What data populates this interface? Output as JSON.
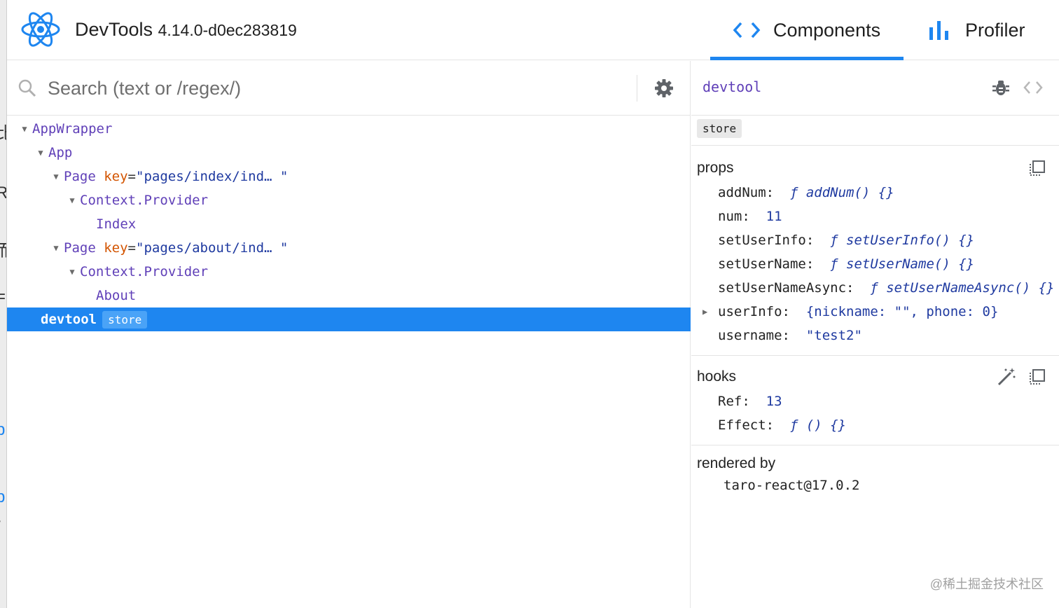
{
  "app": {
    "title": "DevTools",
    "version": "4.14.0-d0ec283819",
    "tabs": [
      {
        "label": "Components",
        "active": true
      },
      {
        "label": "Profiler",
        "active": false
      }
    ]
  },
  "search": {
    "placeholder": "Search (text or /regex/)",
    "value": ""
  },
  "tree": [
    {
      "name": "AppWrapper",
      "depth": 0,
      "expanded": true
    },
    {
      "name": "App",
      "depth": 1,
      "expanded": true
    },
    {
      "name": "Page",
      "key_label": "key",
      "key_value": "\"pages/index/ind… \"",
      "depth": 2,
      "expanded": true
    },
    {
      "name": "Context.Provider",
      "depth": 3,
      "expanded": true
    },
    {
      "name": "Index",
      "depth": 4
    },
    {
      "name": "Page",
      "key_label": "key",
      "key_value": "\"pages/about/ind… \"",
      "depth": 2,
      "expanded": true
    },
    {
      "name": "Context.Provider",
      "depth": 3,
      "expanded": true
    },
    {
      "name": "About",
      "depth": 4
    },
    {
      "name": "devtool",
      "badge": "store",
      "depth": 1,
      "selected": true
    }
  ],
  "inspector": {
    "selected_name": "devtool",
    "hoc_badge": "store",
    "props_title": "props",
    "props": [
      {
        "name": "addNum:",
        "value": "ƒ addNum() {}",
        "type": "function"
      },
      {
        "name": "num:",
        "value": "11",
        "type": "number"
      },
      {
        "name": "setUserInfo:",
        "value": "ƒ setUserInfo() {}",
        "type": "function"
      },
      {
        "name": "setUserName:",
        "value": "ƒ setUserName() {}",
        "type": "function"
      },
      {
        "name": "setUserNameAsync:",
        "value": "ƒ setUserNameAsync() {}",
        "type": "function"
      },
      {
        "name": "userInfo:",
        "value": "{nickname: \"\", phone: 0}",
        "type": "object",
        "expandable": true
      },
      {
        "name": "username:",
        "value": "\"test2\"",
        "type": "string"
      }
    ],
    "hooks_title": "hooks",
    "hooks": [
      {
        "name": "Ref:",
        "value": "13"
      },
      {
        "name": "Effect:",
        "value": "ƒ () {}"
      }
    ],
    "rendered_by_title": "rendered by",
    "renderer": "taro-react@17.0.2"
  },
  "watermark": "@稀土掘金技术社区",
  "colors": {
    "accent": "#1e86f0",
    "component_name": "#6040b8",
    "prop_key": "#d35400",
    "value": "#1f3aa0"
  }
}
